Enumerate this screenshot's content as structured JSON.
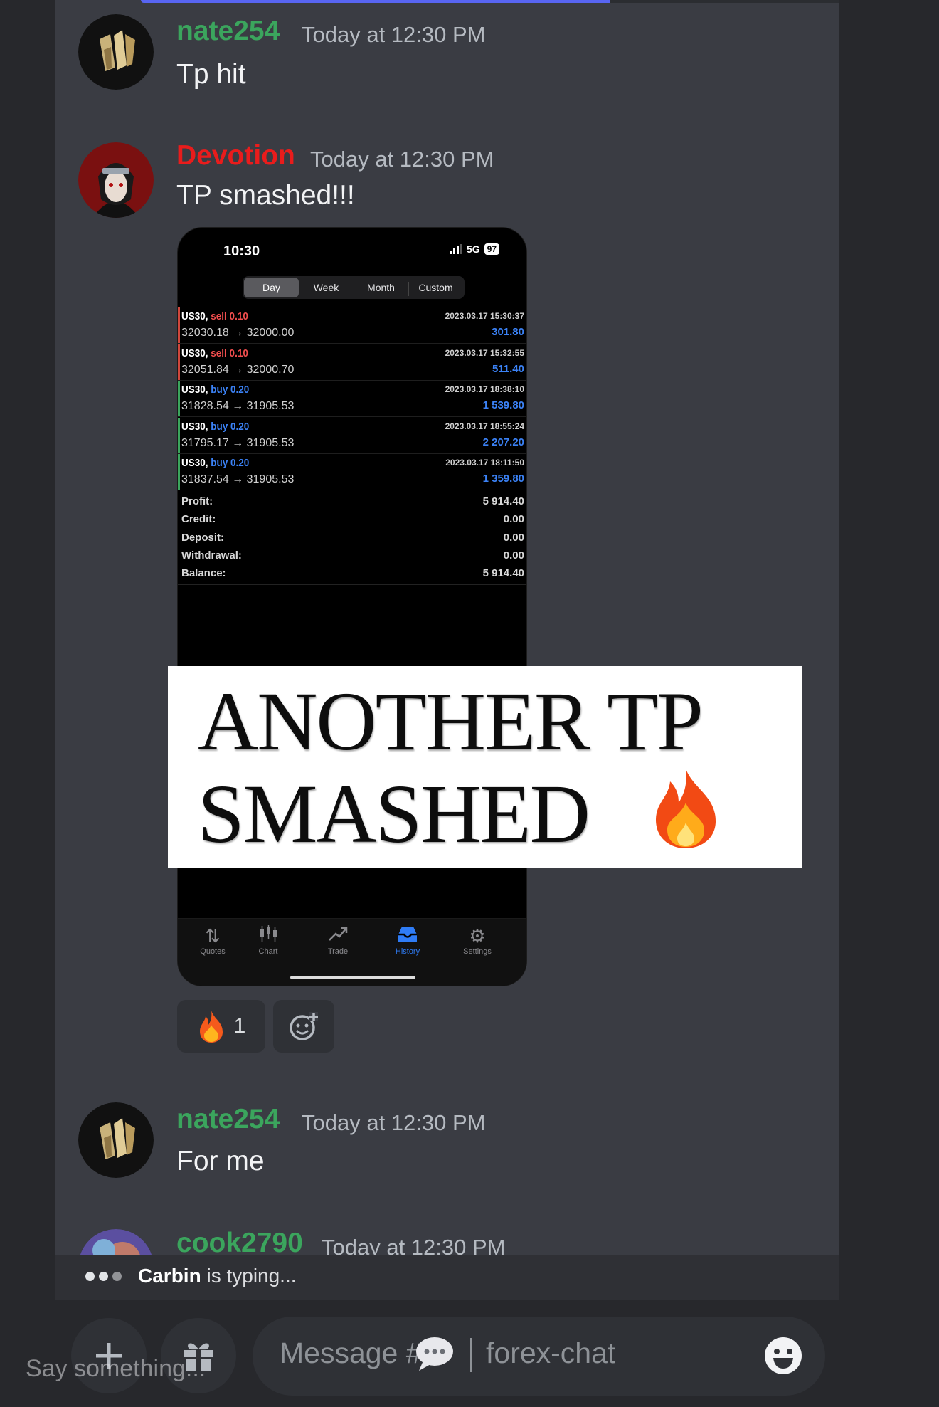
{
  "colors": {
    "nate_name": "#3ba55d",
    "devotion_name": "#e91c1c",
    "cook_name": "#3ba55d",
    "sell": "#f14e4e",
    "buy": "#3b82f6",
    "trade_bar_sell": "#d0473c",
    "trade_bar_buy": "#3ba55d"
  },
  "messages": [
    {
      "username": "nate254",
      "timestamp": "Today at 12:30 PM",
      "text": "Tp hit"
    },
    {
      "username": "Devotion",
      "timestamp": "Today at 12:30 PM",
      "text": "TP smashed!!!"
    },
    {
      "username": "nate254",
      "timestamp": "Today at 12:30 PM",
      "text": "For me"
    },
    {
      "username": "cook2790",
      "timestamp": "Today at 12:30 PM",
      "text": ""
    }
  ],
  "phone": {
    "time": "10:30",
    "network": "5G",
    "battery": "97",
    "tabs": [
      "Day",
      "Week",
      "Month",
      "Custom"
    ],
    "active_tab": "Day",
    "trades": [
      {
        "symbol": "US30,",
        "side": "sell 0.10",
        "type": "sell",
        "prices": "32030.18 → 32000.00",
        "date": "2023.03.17 15:30:37",
        "profit": "301.80"
      },
      {
        "symbol": "US30,",
        "side": "sell 0.10",
        "type": "sell",
        "prices": "32051.84 → 32000.70",
        "date": "2023.03.17 15:32:55",
        "profit": "511.40"
      },
      {
        "symbol": "US30,",
        "side": "buy 0.20",
        "type": "buy",
        "prices": "31828.54 → 31905.53",
        "date": "2023.03.17 18:38:10",
        "profit": "1 539.80"
      },
      {
        "symbol": "US30,",
        "side": "buy 0.20",
        "type": "buy",
        "prices": "31795.17 → 31905.53",
        "date": "2023.03.17 18:55:24",
        "profit": "2 207.20"
      },
      {
        "symbol": "US30,",
        "side": "buy 0.20",
        "type": "buy",
        "prices": "31837.54 → 31905.53",
        "date": "2023.03.17 18:11:50",
        "profit": "1 359.80"
      }
    ],
    "summary": [
      {
        "label": "Profit:",
        "value": "5 914.40"
      },
      {
        "label": "Credit:",
        "value": "0.00"
      },
      {
        "label": "Deposit:",
        "value": "0.00"
      },
      {
        "label": "Withdrawal:",
        "value": "0.00"
      },
      {
        "label": "Balance:",
        "value": "5 914.40"
      }
    ],
    "bottom_tabs": [
      {
        "label": "Quotes",
        "icon": "quotes-icon"
      },
      {
        "label": "Chart",
        "icon": "chart-icon"
      },
      {
        "label": "Trade",
        "icon": "trade-icon"
      },
      {
        "label": "History",
        "icon": "history-icon"
      },
      {
        "label": "Settings",
        "icon": "gear-icon"
      }
    ],
    "active_bottom_tab": "History"
  },
  "banner": {
    "line1": "ANOTHER TP",
    "line2": "SMASHED"
  },
  "reaction": {
    "emoji": "fire-icon",
    "count": "1"
  },
  "typing": {
    "user": "Carbin",
    "suffix": " is typing..."
  },
  "composer": {
    "placeholder": "Message #",
    "channel": "forex-chat",
    "overlay_text": "Say something..."
  }
}
